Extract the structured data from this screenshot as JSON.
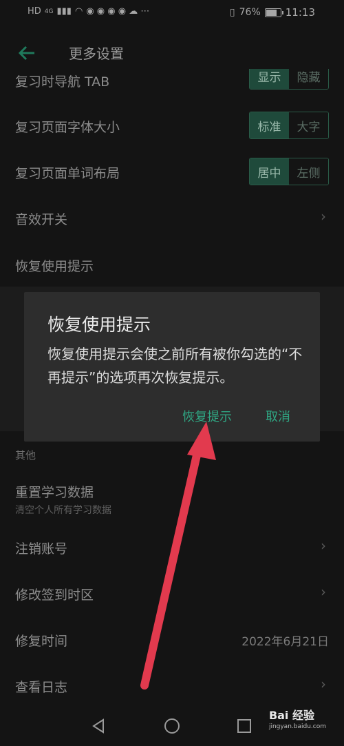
{
  "status_bar": {
    "left_icons": [
      "HD",
      "4G",
      "signal",
      "wifi"
    ],
    "battery_percent": "76%",
    "time": "11:13"
  },
  "app_bar": {
    "title": "更多设置"
  },
  "settings": {
    "nav_tab": {
      "label": "复习时导航 TAB",
      "options": [
        "显示",
        "隐藏"
      ]
    },
    "font_size": {
      "label": "复习页面字体大小",
      "options": [
        "标准",
        "大字"
      ]
    },
    "word_layout": {
      "label": "复习页面单词布局",
      "options": [
        "居中",
        "左侧"
      ]
    },
    "sound": {
      "label": "音效开关"
    },
    "restore_tips": {
      "label": "恢复使用提示"
    }
  },
  "other_section": {
    "header": "其他",
    "reset": {
      "label": "重置学习数据",
      "sub": "清空个人所有学习数据"
    },
    "cancel_account": {
      "label": "注销账号"
    },
    "timezone": {
      "label": "修改签到时区"
    },
    "fix_time": {
      "label": "修复时间",
      "value": "2022年6月21日"
    },
    "logs": {
      "label": "查看日志"
    }
  },
  "dialog": {
    "title": "恢复使用提示",
    "message": "恢复使用提示会使之前所有被你勾选的“不再提示”的选项再次恢复提示。",
    "confirm": "恢复提示",
    "cancel": "取消"
  },
  "watermark": {
    "brand": "Bai 经验",
    "url": "jingyan.baidu.com"
  },
  "colors": {
    "accent": "#2fa683",
    "annotation_arrow": "#e23a4e",
    "dialog_bg": "#2d2d2d"
  }
}
